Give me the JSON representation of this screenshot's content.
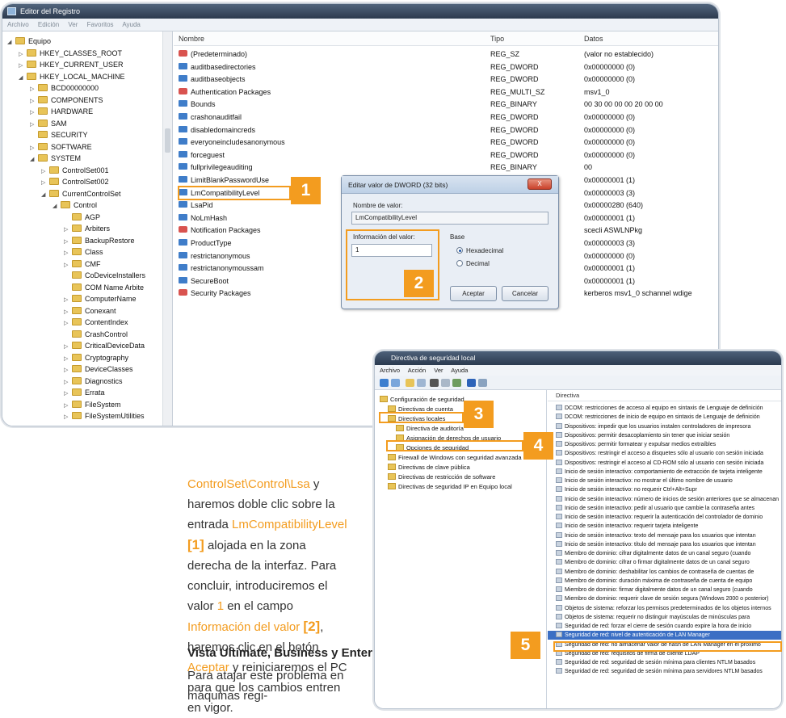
{
  "regedit": {
    "title": "Editor del Registro",
    "menu": [
      "Archivo",
      "Edición",
      "Ver",
      "Favoritos",
      "Ayuda"
    ],
    "tree": [
      {
        "label": "Equipo",
        "indent": 0,
        "tw": "◢"
      },
      {
        "label": "HKEY_CLASSES_ROOT",
        "indent": 1,
        "tw": "▷"
      },
      {
        "label": "HKEY_CURRENT_USER",
        "indent": 1,
        "tw": "▷"
      },
      {
        "label": "HKEY_LOCAL_MACHINE",
        "indent": 1,
        "tw": "◢"
      },
      {
        "label": "BCD00000000",
        "indent": 2,
        "tw": "▷"
      },
      {
        "label": "COMPONENTS",
        "indent": 2,
        "tw": "▷"
      },
      {
        "label": "HARDWARE",
        "indent": 2,
        "tw": "▷"
      },
      {
        "label": "SAM",
        "indent": 2,
        "tw": "▷"
      },
      {
        "label": "SECURITY",
        "indent": 2,
        "tw": ""
      },
      {
        "label": "SOFTWARE",
        "indent": 2,
        "tw": "▷"
      },
      {
        "label": "SYSTEM",
        "indent": 2,
        "tw": "◢"
      },
      {
        "label": "ControlSet001",
        "indent": 3,
        "tw": "▷"
      },
      {
        "label": "ControlSet002",
        "indent": 3,
        "tw": "▷"
      },
      {
        "label": "CurrentControlSet",
        "indent": 3,
        "tw": "◢"
      },
      {
        "label": "Control",
        "indent": 4,
        "tw": "◢"
      },
      {
        "label": "AGP",
        "indent": 5,
        "tw": ""
      },
      {
        "label": "Arbiters",
        "indent": 5,
        "tw": "▷"
      },
      {
        "label": "BackupRestore",
        "indent": 5,
        "tw": "▷"
      },
      {
        "label": "Class",
        "indent": 5,
        "tw": "▷"
      },
      {
        "label": "CMF",
        "indent": 5,
        "tw": "▷"
      },
      {
        "label": "CoDeviceInstallers",
        "indent": 5,
        "tw": ""
      },
      {
        "label": "COM Name Arbite",
        "indent": 5,
        "tw": ""
      },
      {
        "label": "ComputerName",
        "indent": 5,
        "tw": "▷"
      },
      {
        "label": "Conexant",
        "indent": 5,
        "tw": "▷"
      },
      {
        "label": "ContentIndex",
        "indent": 5,
        "tw": "▷"
      },
      {
        "label": "CrashControl",
        "indent": 5,
        "tw": ""
      },
      {
        "label": "CriticalDeviceData",
        "indent": 5,
        "tw": "▷"
      },
      {
        "label": "Cryptography",
        "indent": 5,
        "tw": "▷"
      },
      {
        "label": "DeviceClasses",
        "indent": 5,
        "tw": "▷"
      },
      {
        "label": "Diagnostics",
        "indent": 5,
        "tw": "▷"
      },
      {
        "label": "Errata",
        "indent": 5,
        "tw": "▷"
      },
      {
        "label": "FileSystem",
        "indent": 5,
        "tw": "▷"
      },
      {
        "label": "FileSystemUtilities",
        "indent": 5,
        "tw": "▷"
      }
    ],
    "columns": {
      "name": "Nombre",
      "type": "Tipo",
      "data": "Datos"
    },
    "values": [
      {
        "name": "(Predeterminado)",
        "type": "REG_SZ",
        "data": "(valor no establecido)",
        "icon": "sz"
      },
      {
        "name": "auditbasedirectories",
        "type": "REG_DWORD",
        "data": "0x00000000 (0)",
        "icon": "bn"
      },
      {
        "name": "auditbaseobjects",
        "type": "REG_DWORD",
        "data": "0x00000000 (0)",
        "icon": "bn"
      },
      {
        "name": "Authentication Packages",
        "type": "REG_MULTI_SZ",
        "data": "msv1_0",
        "icon": "sz"
      },
      {
        "name": "Bounds",
        "type": "REG_BINARY",
        "data": "00 30 00 00 00 20 00 00",
        "icon": "bn"
      },
      {
        "name": "crashonauditfail",
        "type": "REG_DWORD",
        "data": "0x00000000 (0)",
        "icon": "bn"
      },
      {
        "name": "disabledomaincreds",
        "type": "REG_DWORD",
        "data": "0x00000000 (0)",
        "icon": "bn"
      },
      {
        "name": "everyoneincludesanonymous",
        "type": "REG_DWORD",
        "data": "0x00000000 (0)",
        "icon": "bn"
      },
      {
        "name": "forceguest",
        "type": "REG_DWORD",
        "data": "0x00000000 (0)",
        "icon": "bn"
      },
      {
        "name": "fullprivilegeauditing",
        "type": "REG_BINARY",
        "data": "00",
        "icon": "bn"
      },
      {
        "name": "LimitBlankPasswordUse",
        "type": "",
        "data": "0x00000001 (1)",
        "icon": "bn"
      },
      {
        "name": "LmCompatibilityLevel",
        "type": "",
        "data": "0x00000003 (3)",
        "icon": "bn"
      },
      {
        "name": "LsaPid",
        "type": "",
        "data": "0x00000280 (640)",
        "icon": "bn"
      },
      {
        "name": "NoLmHash",
        "type": "",
        "data": "0x00000001 (1)",
        "icon": "bn"
      },
      {
        "name": "Notification Packages",
        "type": "",
        "data": "scecli ASWLNPkg",
        "icon": "sz"
      },
      {
        "name": "ProductType",
        "type": "",
        "data": "0x00000003 (3)",
        "icon": "bn"
      },
      {
        "name": "restrictanonymous",
        "type": "",
        "data": "0x00000000 (0)",
        "icon": "bn"
      },
      {
        "name": "restrictanonymoussam",
        "type": "",
        "data": "0x00000001 (1)",
        "icon": "bn"
      },
      {
        "name": "SecureBoot",
        "type": "",
        "data": "0x00000001 (1)",
        "icon": "bn"
      },
      {
        "name": "Security Packages",
        "type": "",
        "data": "kerberos msv1_0 schannel wdige",
        "icon": "sz"
      }
    ]
  },
  "dialog": {
    "title": "Editar valor de DWORD (32 bits)",
    "close": "X",
    "name_label": "Nombre de valor:",
    "name_value": "LmCompatibilityLevel",
    "data_label": "Información del valor:",
    "data_value": "1",
    "base_label": "Base",
    "hex": "Hexadecimal",
    "dec": "Decimal",
    "ok": "Aceptar",
    "cancel": "Cancelar"
  },
  "secpol": {
    "title": "Directiva de seguridad local",
    "menu": [
      "Archivo",
      "Acción",
      "Ver",
      "Ayuda"
    ],
    "tree": [
      {
        "label": "Configuración de seguridad",
        "indent": 0
      },
      {
        "label": "Directivas de cuenta",
        "indent": 1
      },
      {
        "label": "Directivas locales",
        "indent": 1
      },
      {
        "label": "Directiva de auditoría",
        "indent": 2
      },
      {
        "label": "Asignación de derechos de usuario",
        "indent": 2
      },
      {
        "label": "Opciones de seguridad",
        "indent": 2
      },
      {
        "label": "Firewall de Windows con seguridad avanzada",
        "indent": 1
      },
      {
        "label": "Directivas de clave pública",
        "indent": 1
      },
      {
        "label": "Directivas de restricción de software",
        "indent": 1
      },
      {
        "label": "Directivas de seguridad IP en Equipo local",
        "indent": 1
      }
    ],
    "header": "Directiva",
    "policies": [
      "DCOM: restricciones de acceso al equipo en sintaxis de Lenguaje de definición",
      "DCOM: restricciones de inicio de equipo en sintaxis de Lenguaje de definición",
      "Dispositivos: impedir que los usuarios instalen controladores de impresora",
      "Dispositivos: permitir desacoplamiento sin tener que iniciar sesión",
      "Dispositivos: permitir formatear y expulsar medios extraíbles",
      "Dispositivos: restringir el acceso a disquetes sólo al usuario con sesión iniciada",
      "Dispositivos: restringir el acceso al CD-ROM sólo al usuario con sesión iniciada",
      "Inicio de sesión interactivo: comportamiento de extracción de tarjeta inteligente",
      "Inicio de sesión interactivo: no mostrar el último nombre de usuario",
      "Inicio de sesión interactivo: no requerir Ctrl+Alt+Supr",
      "Inicio de sesión interactivo: número de inicios de sesión anteriores que se almacenan",
      "Inicio de sesión interactivo: pedir al usuario que cambie la contraseña antes",
      "Inicio de sesión interactivo: requerir la autenticación del controlador de dominio",
      "Inicio de sesión interactivo: requerir tarjeta inteligente",
      "Inicio de sesión interactivo: texto del mensaje para los usuarios que intentan",
      "Inicio de sesión interactivo: título del mensaje para los usuarios que intentan",
      "Miembro de dominio: cifrar digitalmente datos de un canal seguro (cuando",
      "Miembro de dominio: cifrar o firmar digitalmente datos de un canal seguro",
      "Miembro de dominio: deshabilitar los cambios de contraseña de cuentas de",
      "Miembro de dominio: duración máxima de contraseña de cuenta de equipo",
      "Miembro de dominio: firmar digitalmente datos de un canal seguro (cuando",
      "Miembro de dominio: requerir clave de sesión segura (Windows 2000 o posterior)",
      "Objetos de sistema: reforzar los permisos predeterminados de los objetos internos",
      "Objetos de sistema: requerir no distinguir mayúsculas de minúsculas para",
      "Seguridad de red: forzar el cierre de sesión cuando expire la hora de inicio",
      "Seguridad de red: nivel de autenticación de LAN Manager",
      "Seguridad de red: no almacenar valor de hash de LAN Manager en el próximo",
      "Seguridad de red: requisitos de firma de cliente LDAP",
      "Seguridad de red: seguridad de sesión mínima para clientes NTLM basados",
      "Seguridad de red: seguridad de sesión mínima para servidores NTLM basados"
    ],
    "selected_index": 25
  },
  "callouts": [
    "1",
    "2",
    "3",
    "4",
    "5"
  ],
  "article": {
    "p1_a": "ControlSet\\Control\\Lsa",
    "p1_b": " y haremos doble clic sobre la entrada ",
    "p1_c": "LmCompatibilityLevel",
    "p1_d": "[1]",
    "p1_e": " alojada en la zona derecha de la interfaz. Para concluir, introduciremos el valor ",
    "p1_f": "1",
    "p1_g": " en el campo ",
    "p1_h": "Información del valor",
    "p1_i": "[2]",
    "p1_j": ", haremos clic en el botón ",
    "p1_k": "Aceptar",
    "p1_l": " y reiniciaremos el PC para que los cambios entren en vigor.",
    "heading": "Vista Ultimate, Business y Enterprise",
    "p2": "Para atajar este problema en máquinas regi-"
  }
}
